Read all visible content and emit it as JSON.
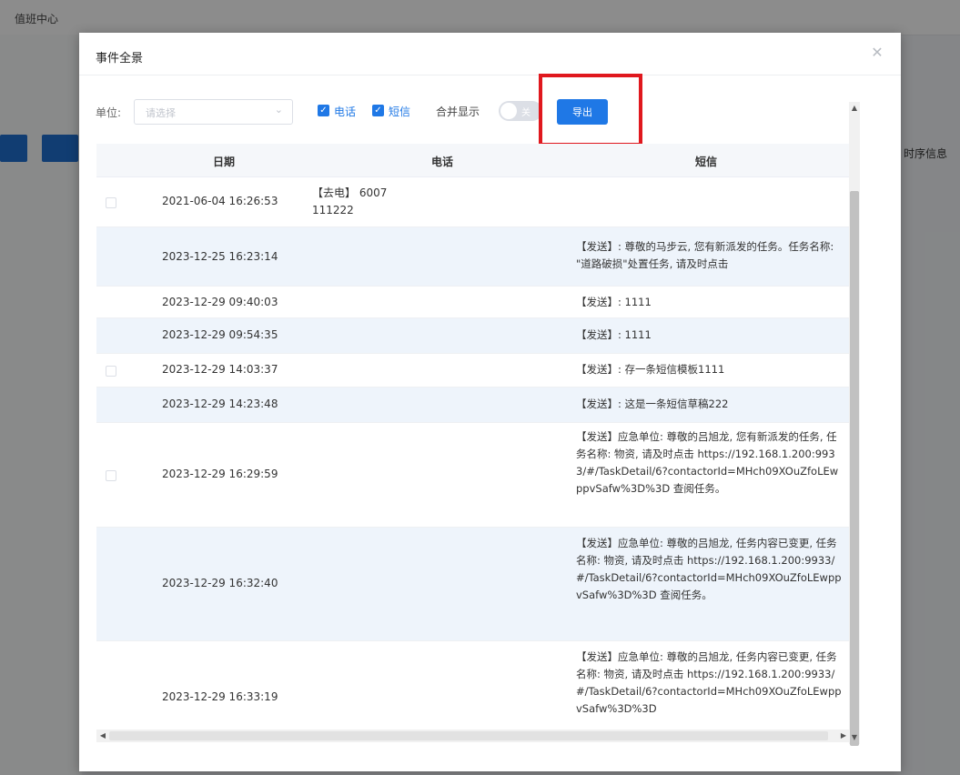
{
  "background": {
    "menu": [
      "值班中心"
    ],
    "right_heading": "时序信息"
  },
  "modal": {
    "title": "事件全景",
    "close_icon": "close-icon"
  },
  "filters": {
    "unit_label": "单位:",
    "unit_placeholder": "请选择",
    "phone_checked": true,
    "phone_label": "电话",
    "sms_checked": true,
    "sms_label": "短信",
    "merge_label": "合并显示",
    "merge_state": "关",
    "export_label": "导出"
  },
  "table": {
    "columns": [
      "日期",
      "电话",
      "短信"
    ],
    "rows": [
      {
        "date": "2021-06-04 16:26:53",
        "phone": "【去电】 6007 111222",
        "sms": ""
      },
      {
        "date": "2023-12-25 16:23:14",
        "phone": "",
        "sms": "【发送】: 尊敬的马步云, 您有新派发的任务。任务名称: \"道路破损\"处置任务, 请及时点击"
      },
      {
        "date": "2023-12-29 09:40:03",
        "phone": "",
        "sms": "【发送】: 1111"
      },
      {
        "date": "2023-12-29 09:54:35",
        "phone": "",
        "sms": "【发送】: 1111"
      },
      {
        "date": "2023-12-29 14:03:37",
        "phone": "",
        "sms": "【发送】: 存一条短信模板1111"
      },
      {
        "date": "2023-12-29 14:23:48",
        "phone": "",
        "sms": "【发送】: 这是一条短信草稿222"
      },
      {
        "date": "2023-12-29 16:29:59",
        "phone": "",
        "sms": "【发送】应急单位: 尊敬的吕旭龙, 您有新派发的任务, 任务名称: 物资, 请及时点击 https://192.168.1.200:9933/#/TaskDetail/6?contactorId=MHch09XOuZfoLEwppvSafw%3D%3D 查阅任务。"
      },
      {
        "date": "2023-12-29 16:32:40",
        "phone": "",
        "sms": "【发送】应急单位: 尊敬的吕旭龙, 任务内容已变更, 任务名称: 物资, 请及时点击 https://192.168.1.200:9933/#/TaskDetail/6?contactorId=MHch09XOuZfoLEwppvSafw%3D%3D 查阅任务。"
      },
      {
        "date": "2023-12-29 16:33:19",
        "phone": "",
        "sms": "【发送】应急单位: 尊敬的吕旭龙, 任务内容已变更, 任务名称: 物资, 请及时点击 https://192.168.1.200:9933/#/TaskDetail/6?contactorId=MHch09XOuZfoLEwppvSafw%3D%3D"
      }
    ]
  },
  "colors": {
    "accent": "#1f78e6",
    "highlight": "#e0181e",
    "row_alt": "#eef4fb"
  }
}
